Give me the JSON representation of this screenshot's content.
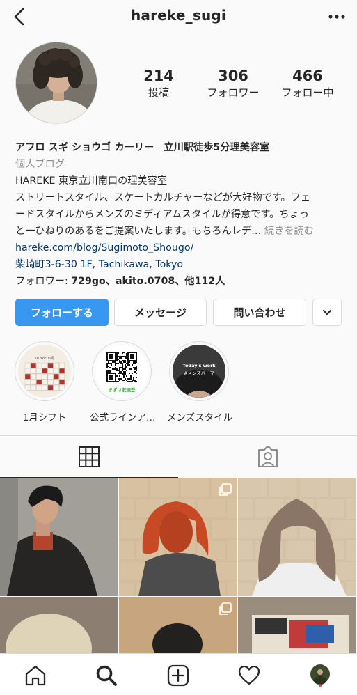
{
  "header": {
    "username": "hareke_sugi"
  },
  "stats": [
    {
      "value": "214",
      "label": "投稿"
    },
    {
      "value": "306",
      "label": "フォロワー"
    },
    {
      "value": "466",
      "label": "フォロー中"
    }
  ],
  "bio": {
    "name": "アフロ スギ ショウゴ カーリー　立川駅徒歩5分理美容室",
    "category": "個人ブログ",
    "line1": "HAREKE 東京立川南口の理美容室",
    "line2": "ストリートスタイル、スケートカルチャーなどが大好物です。フェ",
    "line3": "ードスタイルからメンズのミディアムスタイルが得意です。ちょっ",
    "line4": "と一ひねりのあるをご提案いたします。もちろんレデ…",
    "more": "続きを読む",
    "website": "hareke.com/blog/Sugimoto_Shougo/",
    "address": "柴崎町3-6-30 1F, Tachikawa, Tokyo",
    "followed_prefix": "フォロワー: ",
    "followed_names": "729go、akito.0708",
    "followed_suffix": "、他112人"
  },
  "buttons": {
    "follow": "フォローする",
    "message": "メッセージ",
    "contact": "問い合わせ"
  },
  "highlights": [
    {
      "label": "1月シフト",
      "calendar_title": "2020年01月"
    },
    {
      "label": "公式ラインア…",
      "caption": "まずは友達登"
    },
    {
      "label": "メンズスタイル",
      "title": "Today's work",
      "subtitle": "#メンズパーマ"
    }
  ],
  "colors": {
    "accent": "#3897f0",
    "link": "#00376b",
    "muted": "#8e8e8e",
    "border": "#dbdbdb",
    "notification": "#ed4956"
  }
}
